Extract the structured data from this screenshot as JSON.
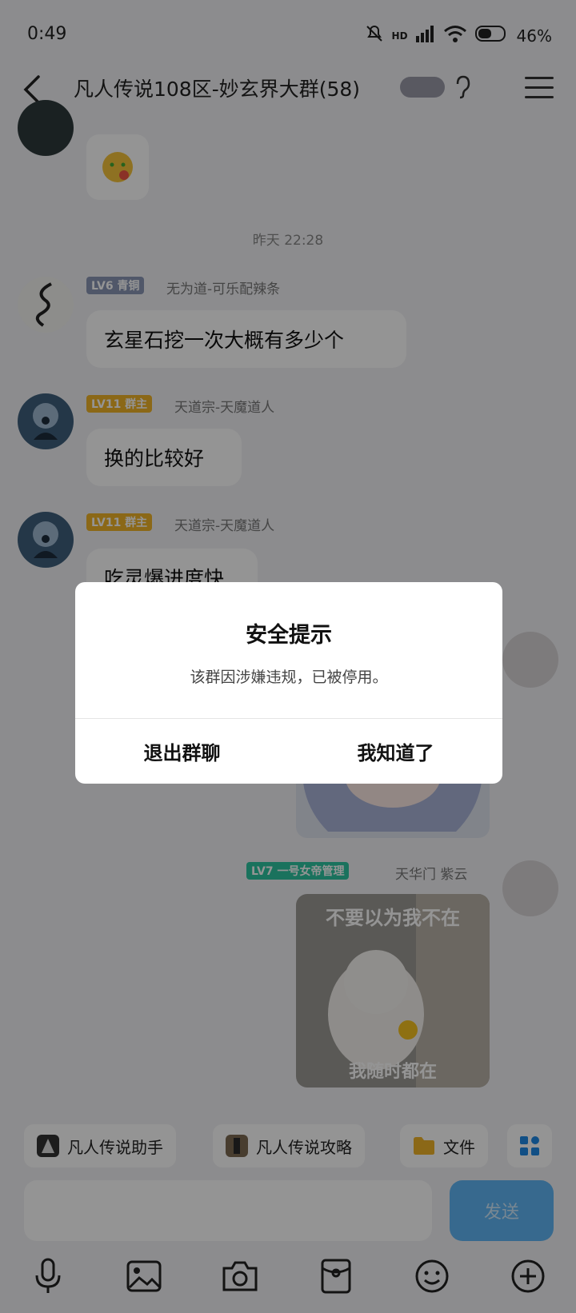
{
  "status": {
    "time": "0:49",
    "battery": "46%",
    "network": "HD"
  },
  "header": {
    "title": "凡人传说108区-妙玄界大群(58)"
  },
  "chat": {
    "timestamp": "昨天 22:28",
    "messages": [
      {
        "level": "LV6 青铜",
        "nick": "无为道-可乐配辣条",
        "text": "玄星石挖一次大概有多少个"
      },
      {
        "level": "LV11 群主",
        "nick": "天道宗-天魔道人",
        "text": "换的比较好"
      },
      {
        "level": "LV11 群主",
        "nick": "天道宗-天魔道人",
        "text": "吃灵爆进度快"
      },
      {
        "level": "LV7 一号女帝管理",
        "nick": "天华门 紫云",
        "sticker_top": "不要以为我不在",
        "sticker_bottom": "我随时都在"
      }
    ]
  },
  "shortcuts": [
    {
      "label": "凡人传说助手"
    },
    {
      "label": "凡人传说攻略"
    },
    {
      "label": "文件"
    }
  ],
  "composer": {
    "send_label": "发送"
  },
  "dialog": {
    "title": "安全提示",
    "message": "该群因涉嫌违规，已被停用。",
    "exit_label": "退出群聊",
    "ok_label": "我知道了"
  },
  "colors": {
    "lv6": "#8a97b6",
    "owner": "#f0b429",
    "admin": "#2ec4a0",
    "send": "#5fb6f4"
  }
}
